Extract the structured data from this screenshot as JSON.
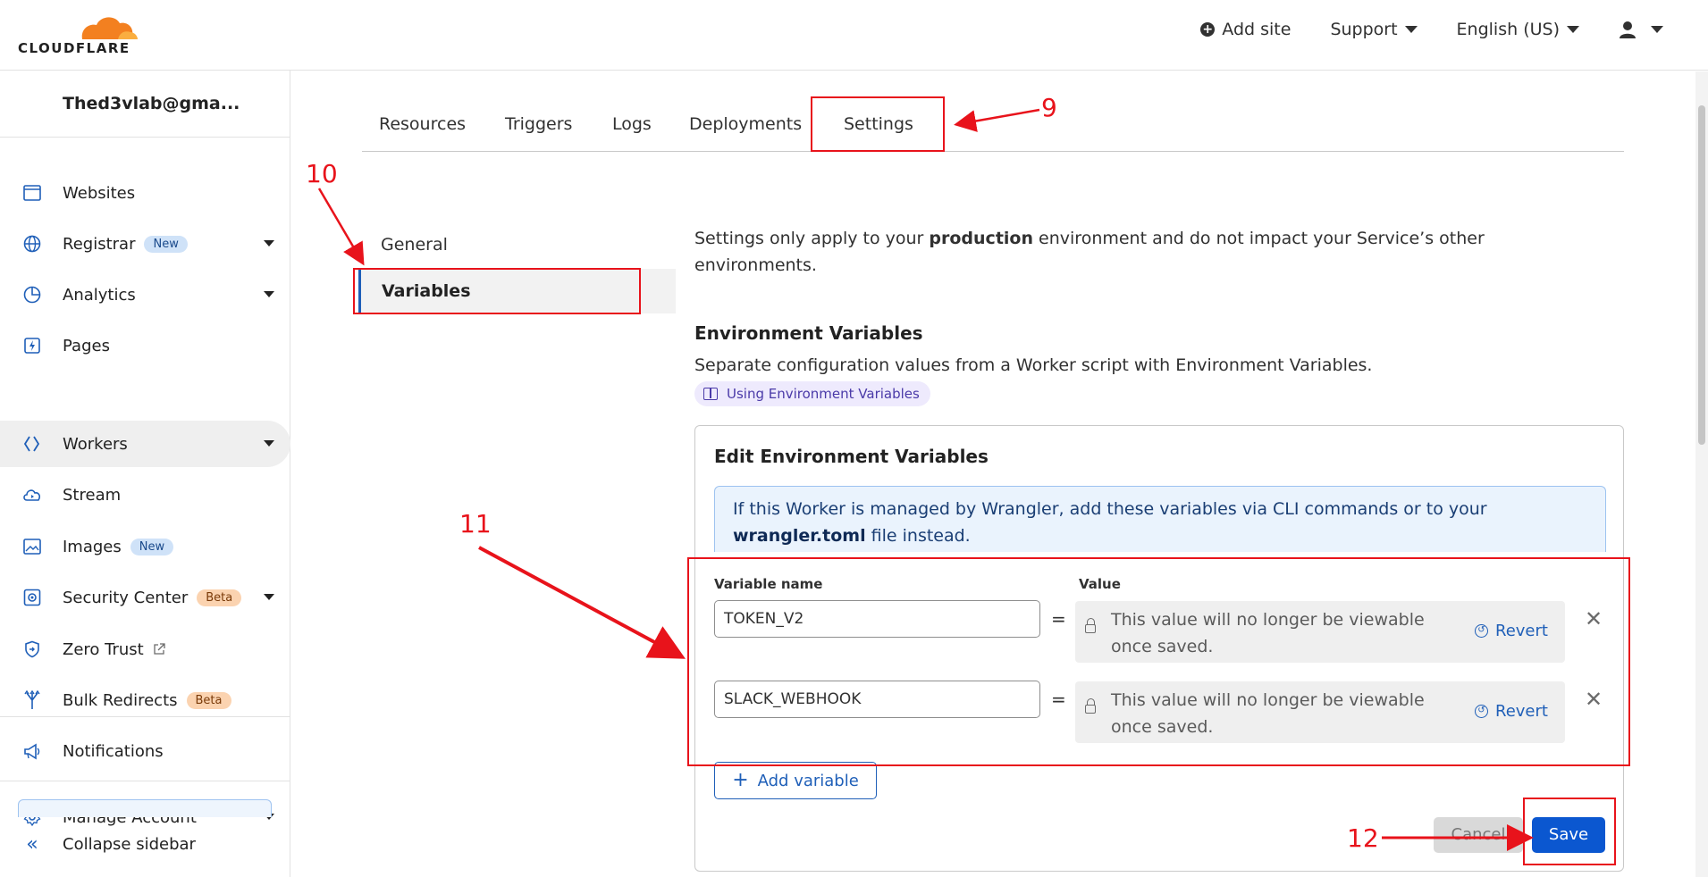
{
  "header": {
    "logo_text": "CLOUDFLARE",
    "add_site": "Add site",
    "support": "Support",
    "language": "English (US)"
  },
  "sidebar": {
    "account": "Thed3vlab@gma...",
    "items": [
      {
        "label": "Websites"
      },
      {
        "label": "Registrar",
        "badge": "New"
      },
      {
        "label": "Analytics"
      },
      {
        "label": "Pages"
      },
      {
        "label": "Workers"
      },
      {
        "label": "Stream"
      },
      {
        "label": "Images",
        "badge": "New"
      },
      {
        "label": "Security Center",
        "badge": "Beta"
      },
      {
        "label": "Zero Trust"
      },
      {
        "label": "Bulk Redirects",
        "badge": "Beta"
      },
      {
        "label": "Notifications"
      },
      {
        "label": "Manage Account"
      }
    ],
    "collapse": "Collapse sidebar"
  },
  "tabs": [
    "Resources",
    "Triggers",
    "Logs",
    "Deployments",
    "Settings"
  ],
  "subnav": {
    "general": "General",
    "variables": "Variables"
  },
  "settings": {
    "intro_prefix": "Settings only apply to your ",
    "intro_bold": "production",
    "intro_suffix": " environment and do not impact your Service’s other environments.",
    "env_heading": "Environment Variables",
    "env_desc": "Separate configuration values from a Worker script with Environment Variables.",
    "doc_link": "Using Environment Variables"
  },
  "card": {
    "title": "Edit Environment Variables",
    "info_prefix": "If this Worker is managed by Wrangler, add these variables via CLI commands or to your ",
    "info_bold": "wrangler.toml",
    "info_suffix": " file instead.",
    "col_name": "Variable name",
    "col_value": "Value",
    "rows": [
      {
        "name": "TOKEN_V2",
        "value_note": "This value will no longer be viewable once saved.",
        "revert": "Revert"
      },
      {
        "name": "SLACK_WEBHOOK",
        "value_note": "This value will no longer be viewable once saved.",
        "revert": "Revert"
      }
    ],
    "add_variable": "Add variable",
    "cancel": "Cancel",
    "save": "Save"
  },
  "annotations": {
    "n9": "9",
    "n10": "10",
    "n11": "11",
    "n12": "12",
    "color": "#e8131b"
  }
}
